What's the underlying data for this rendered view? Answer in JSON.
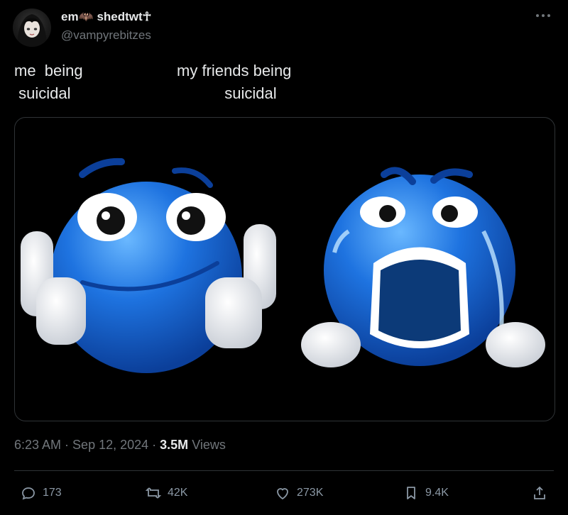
{
  "author": {
    "display_name": "em🦇 shedtwt☥",
    "handle": "@vampyrebitzes"
  },
  "tweet": {
    "text_left": "me  being\n suicidal",
    "text_right": "my friends being\n           suicidal",
    "image_description": "blue emoji thumbs up vs blue emoji crying"
  },
  "meta": {
    "time": "6:23 AM",
    "sep1": " · ",
    "date": "Sep 12, 2024",
    "sep2": " · ",
    "views_count": "3.5M",
    "views_label": " Views"
  },
  "actions": {
    "replies": "173",
    "reposts": "42K",
    "likes": "273K",
    "bookmarks": "9.4K"
  },
  "icons": [
    "more-icon",
    "reply-icon",
    "repost-icon",
    "like-icon",
    "bookmark-icon",
    "share-icon"
  ],
  "colors": {
    "background": "#000000",
    "text": "#e7e9ea",
    "muted": "#71767b",
    "emoji_blue": "#1e73e0"
  }
}
